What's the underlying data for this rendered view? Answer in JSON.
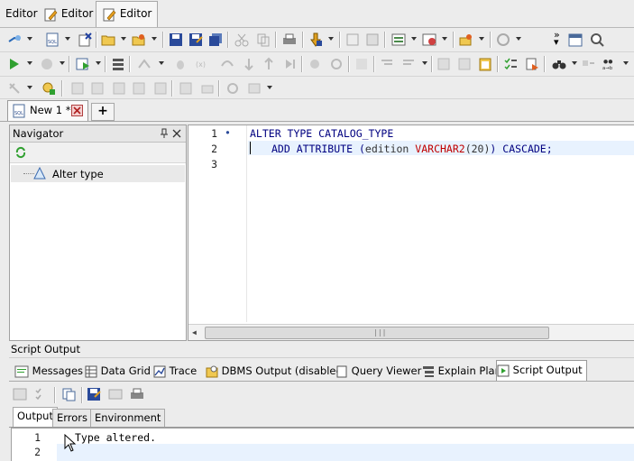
{
  "top_tabs": [
    {
      "label": "Editor"
    },
    {
      "label": "Editor"
    },
    {
      "label": "Editor"
    }
  ],
  "doc_tab": {
    "label": "New 1 *"
  },
  "navigator": {
    "title": "Navigator",
    "item": "Alter type"
  },
  "editor": {
    "lines": [
      {
        "num": "1",
        "marker": "•"
      },
      {
        "num": "2",
        "marker": ""
      },
      {
        "num": "3",
        "marker": ""
      }
    ],
    "code": {
      "l1": "ALTER TYPE CATALOG_TYPE",
      "l2_kw1": "ADD ATTRIBUTE",
      "l2_paren_open": "(",
      "l2_ident": "edition",
      "l2_type": "VARCHAR2",
      "l2_len": "(20)",
      "l2_paren_close": ")",
      "l2_kw2": "CASCADE;"
    }
  },
  "script_output": {
    "title": "Script Output",
    "tabs": [
      {
        "label": "Messages"
      },
      {
        "label": "Data Grid"
      },
      {
        "label": "Trace"
      },
      {
        "label": "DBMS Output (disabled)"
      },
      {
        "label": "Query Viewer"
      },
      {
        "label": "Explain Plan"
      },
      {
        "label": "Script Output"
      }
    ],
    "out_tabs": [
      {
        "label": "Output"
      },
      {
        "label": "Errors"
      },
      {
        "label": "Environment"
      }
    ],
    "lines": [
      {
        "num": "1",
        "text": "Type altered."
      },
      {
        "num": "2",
        "text": ""
      }
    ]
  },
  "colors": {
    "keyword": "#000080",
    "type": "#c00000",
    "highlight": "#e8f2fe"
  }
}
